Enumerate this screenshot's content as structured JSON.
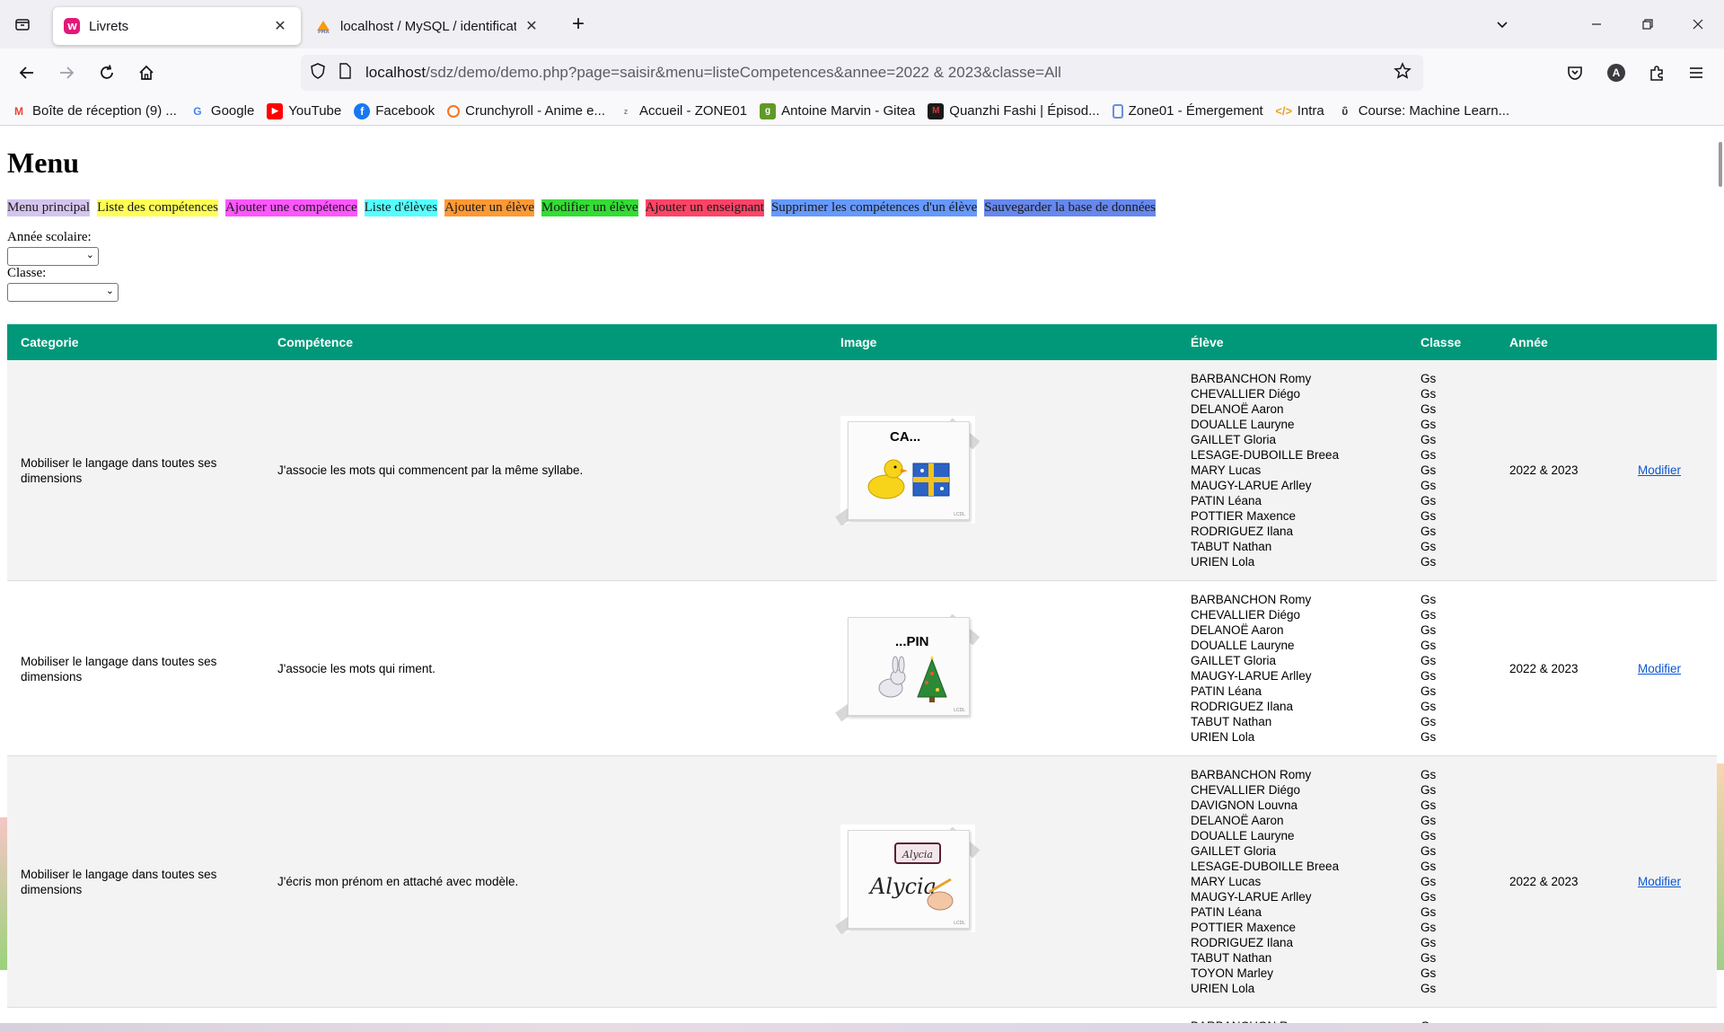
{
  "browser": {
    "tabs": [
      {
        "title": "Livrets",
        "active": true,
        "icon": "wampserver-icon",
        "close": "✕"
      },
      {
        "title": "localhost / MySQL / identificati",
        "active": false,
        "icon": "phpmyadmin-icon",
        "close": "✕"
      }
    ],
    "new_tab": "+",
    "url_host": "localhost",
    "url_path": "/sdz/demo/demo.php?page=saisir&menu=listeCompetences&annee=2022 & 2023&classe=All",
    "profile_initial": "A",
    "bookmarks": [
      {
        "label": "Boîte de réception (9) ...",
        "icon": "gmail-icon",
        "color": "#ea4335"
      },
      {
        "label": "Google",
        "icon": "google-icon",
        "color": "#4285f4"
      },
      {
        "label": "YouTube",
        "icon": "youtube-icon",
        "color": "#ff0000"
      },
      {
        "label": "Facebook",
        "icon": "facebook-icon",
        "color": "#1877f2"
      },
      {
        "label": "Crunchyroll - Anime e...",
        "icon": "crunchyroll-icon",
        "color": "#f47521"
      },
      {
        "label": "Accueil - ZONE01",
        "icon": "zone01-icon",
        "color": "#888888"
      },
      {
        "label": "Antoine Marvin - Gitea",
        "icon": "gitea-icon",
        "color": "#609926"
      },
      {
        "label": "Quanzhi Fashi | Épisod...",
        "icon": "quanzhi-icon",
        "color": "#8b0000"
      },
      {
        "label": "Zone01 - Émergement",
        "icon": "zone01-emargement-icon",
        "color": "#6a8fd8"
      },
      {
        "label": "Intra",
        "icon": "code-icon",
        "color": "#f0a020"
      },
      {
        "label": "Course: Machine Learn...",
        "icon": "course-icon",
        "color": "#333333"
      }
    ]
  },
  "page": {
    "title": "Menu",
    "menu": [
      {
        "label": "Menu principal",
        "color": "#d4c4ee"
      },
      {
        "label": "Liste des compétences",
        "color": "#ffff55"
      },
      {
        "label": "Ajouter une compétence",
        "color": "#ff55ff"
      },
      {
        "label": "Liste d'élèves",
        "color": "#55ffff"
      },
      {
        "label": "Ajouter un élève",
        "color": "#ff9933"
      },
      {
        "label": "Modifier un élève",
        "color": "#33dd33"
      },
      {
        "label": "Ajouter un enseignant",
        "color": "#ff4466"
      },
      {
        "label": "Supprimer les compétences d'un élève",
        "color": "#6699ff"
      },
      {
        "label": "Sauvegarder la base de données",
        "color": "#6688ee"
      }
    ],
    "filters": {
      "year_label": "Année scolaire:",
      "class_label": "Classe:"
    },
    "table": {
      "header_color": "#009879",
      "headers": [
        "Categorie",
        "Compétence",
        "Image",
        "Élève",
        "Classe",
        "Année"
      ],
      "rows": [
        {
          "categorie": "Mobiliser le langage dans toutes ses dimensions",
          "competence": "J'associe les mots qui commencent par la même syllabe.",
          "image_caption": "CA...",
          "image_signature": "LCDL",
          "eleves": [
            "BARBANCHON Romy",
            "CHEVALLIER Diégo",
            "DELANOË Aaron",
            "DOUALLE Lauryne",
            "GAILLET Gloria",
            "LESAGE-DUBOILLE Breea",
            "MARY Lucas",
            "MAUGY-LARUE Arlley",
            "PATIN Léana",
            "POTTIER Maxence",
            "RODRIGUEZ Ilana",
            "TABUT Nathan",
            "URIEN Lola"
          ],
          "classe": "Gs",
          "annee": "2022 & 2023",
          "action": "Modifier"
        },
        {
          "categorie": "Mobiliser le langage dans toutes ses dimensions",
          "competence": "J'associe les mots qui riment.",
          "image_caption": "...PIN",
          "image_signature": "LCDL",
          "eleves": [
            "BARBANCHON Romy",
            "CHEVALLIER Diégo",
            "DELANOË Aaron",
            "DOUALLE Lauryne",
            "GAILLET Gloria",
            "MAUGY-LARUE Arlley",
            "PATIN Léana",
            "RODRIGUEZ Ilana",
            "TABUT Nathan",
            "URIEN Lola"
          ],
          "classe": "Gs",
          "annee": "2022 & 2023",
          "action": "Modifier"
        },
        {
          "categorie": "Mobiliser le langage dans toutes ses dimensions",
          "competence": "J'écris mon prénom en attaché avec modèle.",
          "image_caption": "Alycia",
          "image_signature": "LCDL",
          "eleves": [
            "BARBANCHON Romy",
            "CHEVALLIER Diégo",
            "DAVIGNON Louvna",
            "DELANOË Aaron",
            "DOUALLE Lauryne",
            "GAILLET Gloria",
            "LESAGE-DUBOILLE Breea",
            "MARY Lucas",
            "MAUGY-LARUE Arlley",
            "PATIN Léana",
            "POTTIER Maxence",
            "RODRIGUEZ Ilana",
            "TABUT Nathan",
            "TOYON Marley",
            "URIEN Lola"
          ],
          "classe": "Gs",
          "annee": "2022 & 2023",
          "action": "Modifier"
        }
      ],
      "partial_next": "BARBANCHON R"
    }
  }
}
